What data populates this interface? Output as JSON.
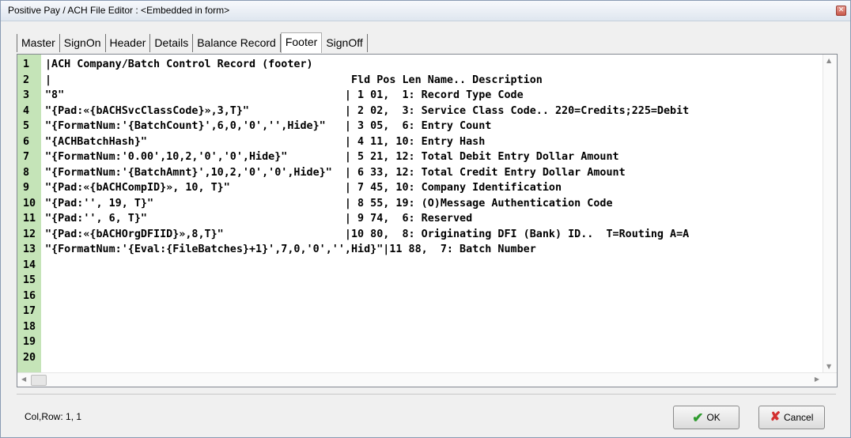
{
  "window": {
    "title": "Positive Pay / ACH File Editor : <Embedded in form>",
    "close_icon": "close-icon"
  },
  "tabs": [
    {
      "label": "Master",
      "active": false
    },
    {
      "label": "SignOn",
      "active": false
    },
    {
      "label": "Header",
      "active": false
    },
    {
      "label": "Details",
      "active": false
    },
    {
      "label": "Balance Record",
      "active": false
    },
    {
      "label": "Footer",
      "active": true
    },
    {
      "label": "SignOff",
      "active": false
    }
  ],
  "editor": {
    "lines": [
      {
        "num": "1",
        "text": "|ACH Company/Batch Control Record (footer)"
      },
      {
        "num": "2",
        "text": "|                                               Fld Pos Len Name.. Description"
      },
      {
        "num": "3",
        "text": "\"8\"                                            | 1 01,  1: Record Type Code"
      },
      {
        "num": "4",
        "text": "\"{Pad:«{bACHSvcClassCode}»,3,T}\"               | 2 02,  3: Service Class Code.. 220=Credits;225=Debit"
      },
      {
        "num": "5",
        "text": "\"{FormatNum:'{BatchCount}',6,0,'0','',Hide}\"   | 3 05,  6: Entry Count"
      },
      {
        "num": "6",
        "text": "\"{ACHBatchHash}\"                               | 4 11, 10: Entry Hash"
      },
      {
        "num": "7",
        "text": "\"{FormatNum:'0.00',10,2,'0','0',Hide}\"         | 5 21, 12: Total Debit Entry Dollar Amount"
      },
      {
        "num": "8",
        "text": "\"{FormatNum:'{BatchAmnt}',10,2,'0','0',Hide}\"  | 6 33, 12: Total Credit Entry Dollar Amount"
      },
      {
        "num": "9",
        "text": "\"{Pad:«{bACHCompID}», 10, T}\"                  | 7 45, 10: Company Identification"
      },
      {
        "num": "10",
        "text": "\"{Pad:'', 19, T}\"                              | 8 55, 19: (O)Message Authentication Code"
      },
      {
        "num": "11",
        "text": "\"{Pad:'', 6, T}\"                               | 9 74,  6: Reserved"
      },
      {
        "num": "12",
        "text": "\"{Pad:«{bACHOrgDFIID}»,8,T}\"                   |10 80,  8: Originating DFI (Bank) ID..  T=Routing A=A"
      },
      {
        "num": "13",
        "text": "\"{FormatNum:'{Eval:{FileBatches}+1}',7,0,'0','',Hid}\"|11 88,  7: Batch Number"
      },
      {
        "num": "14",
        "text": ""
      },
      {
        "num": "15",
        "text": ""
      },
      {
        "num": "16",
        "text": ""
      },
      {
        "num": "17",
        "text": ""
      },
      {
        "num": "18",
        "text": ""
      },
      {
        "num": "19",
        "text": ""
      },
      {
        "num": "20",
        "text": ""
      }
    ]
  },
  "status": {
    "text": "Col,Row: 1, 1"
  },
  "buttons": {
    "ok_label": "OK",
    "cancel_label": "Cancel",
    "ok_icon": "check-icon",
    "cancel_icon": "x-icon"
  },
  "colors": {
    "gutter": "#c5e4b8",
    "ok_check": "#2e9b2e",
    "cancel_x": "#d32f2f"
  }
}
